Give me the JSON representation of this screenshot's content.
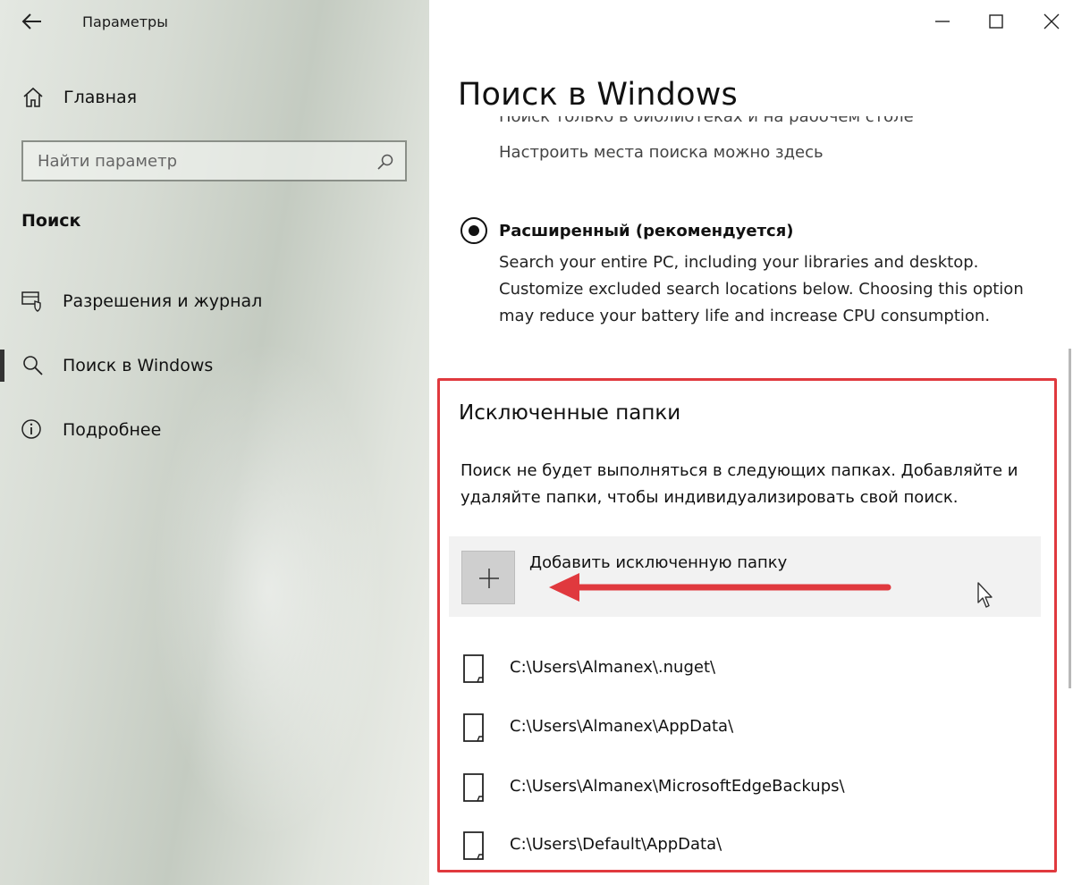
{
  "window": {
    "app_title": "Параметры"
  },
  "sidebar": {
    "home_label": "Главная",
    "search_placeholder": "Найти параметр",
    "section_title": "Поиск",
    "items": [
      {
        "label": "Разрешения и журнал",
        "icon": "permissions-icon",
        "active": false
      },
      {
        "label": "Поиск в Windows",
        "icon": "search-icon",
        "active": true
      },
      {
        "label": "Подробнее",
        "icon": "info-icon",
        "active": false
      }
    ]
  },
  "main": {
    "page_title": "Поиск в Windows",
    "cut_off_text": "Поиск только в библиотеках и на рабочем столе",
    "configure_text": "Настроить места поиска можно здесь",
    "enhanced_option": {
      "label": "Расширенный (рекомендуется)",
      "selected": true,
      "description": "Search your entire PC, including your libraries and desktop. Customize excluded search locations below. Choosing this option may reduce your battery life and increase CPU consumption."
    },
    "excluded": {
      "title": "Исключенные папки",
      "description": "Поиск не будет выполняться в следующих папках. Добавляйте и удаляйте папки, чтобы индивидуализировать свой поиск.",
      "add_label": "Добавить исключенную папку",
      "folders": [
        "C:\\Users\\Almanex\\.nuget\\",
        "C:\\Users\\Almanex\\AppData\\",
        "C:\\Users\\Almanex\\MicrosoftEdgeBackups\\",
        "C:\\Users\\Default\\AppData\\"
      ]
    }
  },
  "colors": {
    "highlight": "#e0393e",
    "active_indicator": "#333333"
  }
}
